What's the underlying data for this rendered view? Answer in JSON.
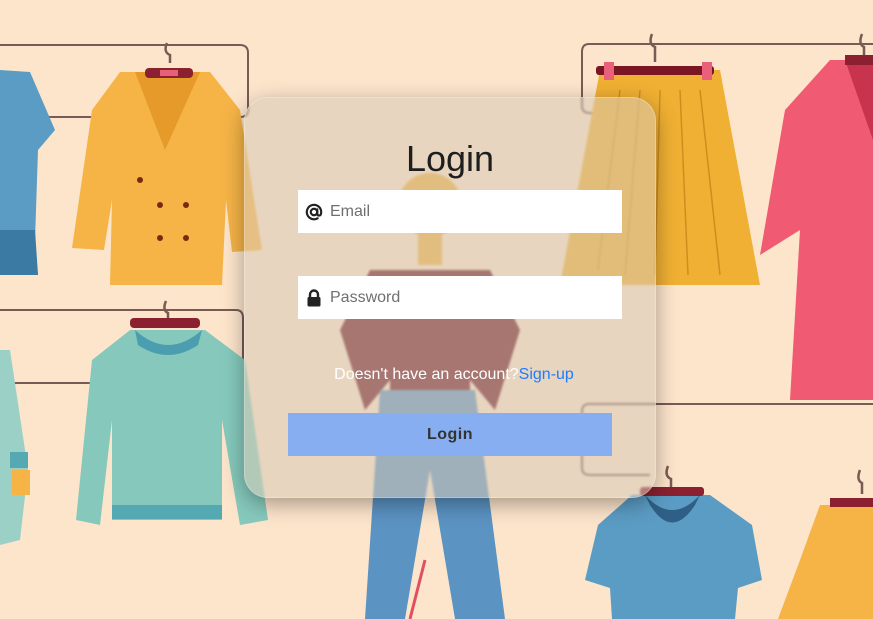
{
  "login_form": {
    "title": "Login",
    "email_placeholder": "Email",
    "password_placeholder": "Password",
    "signup_prompt": "Doesn't have an account?",
    "signup_link": "Sign-up",
    "login_button": "Login"
  },
  "icons": {
    "email": "at-sign-icon",
    "password": "lock-icon"
  },
  "colors": {
    "background": "#fde5cc",
    "login_button": "#86aef0",
    "signup_link": "#1f7cff"
  }
}
